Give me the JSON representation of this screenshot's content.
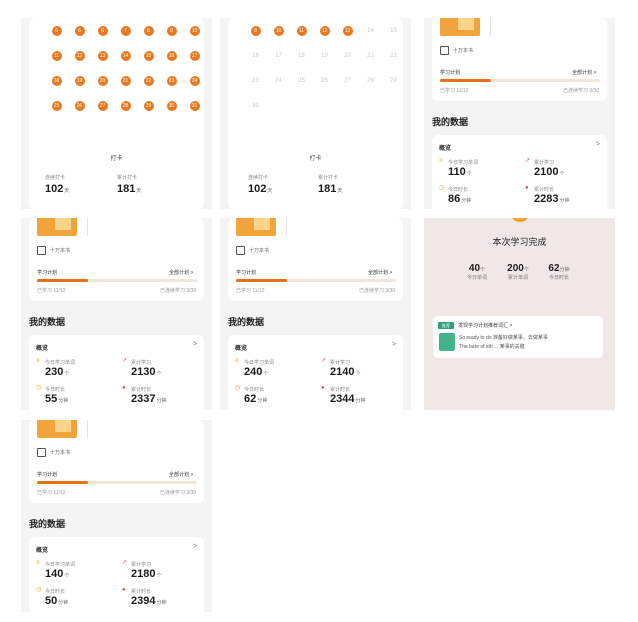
{
  "calendar": {
    "rows_a": [
      [
        "6",
        "6",
        "6",
        "7",
        "8",
        "9",
        "10"
      ],
      [
        "11",
        "12",
        "13",
        "14",
        "15",
        "16",
        "17"
      ],
      [
        "18",
        "19",
        "20",
        "21",
        "22",
        "23",
        "24"
      ],
      [
        "25",
        "26",
        "27",
        "28",
        "29",
        "30",
        "31"
      ]
    ],
    "rows_b_marked": [
      "9",
      "10",
      "11",
      "12",
      "13"
    ],
    "rows_b_plain": [
      [
        "14"
      ],
      [
        "15",
        "16",
        "17",
        "18",
        "19",
        "20",
        "21"
      ],
      [
        "22",
        "23",
        "24",
        "25",
        "26",
        "27",
        "28"
      ],
      [
        "29",
        "30"
      ]
    ],
    "sign_label": "打卡",
    "stat1_label": "连续打卡",
    "stat1_value": "102",
    "stat1_unit": "天",
    "stat2_label": "累计打卡",
    "stat2_value": "181",
    "stat2_unit": "天"
  },
  "plan": {
    "book_label": "十万本书",
    "title": "学习计划",
    "link": "全部计划 >",
    "sub_left": "已学习 11/12",
    "sub_right": "已连续学习 3/30"
  },
  "my_data": {
    "title": "我的数据",
    "overview": "概览",
    "chevron": ">",
    "label_today_words": "今日学习单词",
    "label_total_words": "累计学习",
    "label_today_time": "今日时长",
    "label_total_time": "累计时长",
    "unit_words": "个",
    "unit_min": "分钟",
    "unit_min_total": "分钟"
  },
  "snapshots": [
    {
      "today_words": "110",
      "total_words": "2100",
      "today_time": "86",
      "total_time": "2283"
    },
    {
      "today_words": "230",
      "total_words": "2130",
      "today_time": "55",
      "total_time": "2337"
    },
    {
      "today_words": "240",
      "total_words": "2140",
      "today_time": "62",
      "total_time": "2344"
    },
    {
      "today_words": "140",
      "total_words": "2180",
      "today_time": "50",
      "total_time": "2394"
    }
  ],
  "completion": {
    "title": "本次学习完成",
    "s1_value": "40",
    "s1_unit": "个",
    "s1_label": "今日单词",
    "s2_value": "200",
    "s2_unit": "个",
    "s2_label": "累计单词",
    "s3_value": "62",
    "s3_unit": "分钟",
    "s3_label": "今日时长",
    "tip_header": "发现学习计划推荐词汇 >",
    "tip_badge": "推荐",
    "tip_line1": "So ready to do 准备好做某事，去做某事",
    "tip_line2": "The bare of sth ... 某事的关键"
  }
}
